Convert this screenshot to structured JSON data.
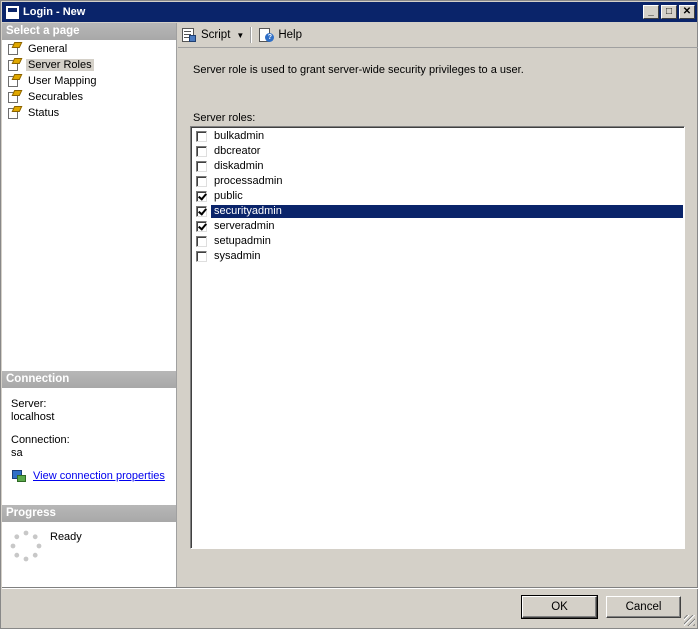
{
  "window": {
    "title": "Login - New"
  },
  "titlebar_buttons": {
    "minimize": "_",
    "maximize": "□",
    "close": "✕"
  },
  "left": {
    "select_page_header": "Select a page",
    "pages": [
      {
        "label": "General",
        "selected": false
      },
      {
        "label": "Server Roles",
        "selected": true
      },
      {
        "label": "User Mapping",
        "selected": false
      },
      {
        "label": "Securables",
        "selected": false
      },
      {
        "label": "Status",
        "selected": false
      }
    ],
    "connection_header": "Connection",
    "server_label": "Server:",
    "server_value": "localhost",
    "connection_label": "Connection:",
    "connection_value": "sa",
    "view_link": "View connection properties",
    "progress_header": "Progress",
    "progress_status": "Ready"
  },
  "toolbar": {
    "script_label": "Script",
    "help_label": "Help"
  },
  "main": {
    "description": "Server role is used to grant server-wide security privileges to a user.",
    "roles_label": "Server roles:",
    "roles": [
      {
        "name": "bulkadmin",
        "checked": false,
        "selected": false
      },
      {
        "name": "dbcreator",
        "checked": false,
        "selected": false
      },
      {
        "name": "diskadmin",
        "checked": false,
        "selected": false
      },
      {
        "name": "processadmin",
        "checked": false,
        "selected": false
      },
      {
        "name": "public",
        "checked": true,
        "selected": false
      },
      {
        "name": "securityadmin",
        "checked": true,
        "selected": true
      },
      {
        "name": "serveradmin",
        "checked": true,
        "selected": false
      },
      {
        "name": "setupadmin",
        "checked": false,
        "selected": false
      },
      {
        "name": "sysadmin",
        "checked": false,
        "selected": false
      }
    ]
  },
  "buttons": {
    "ok": "OK",
    "cancel": "Cancel"
  },
  "colors": {
    "titlebar": "#0a246a",
    "selection": "#0a246a",
    "face": "#d4d0c8",
    "section_header": "#acacac",
    "link": "#0000ee"
  }
}
